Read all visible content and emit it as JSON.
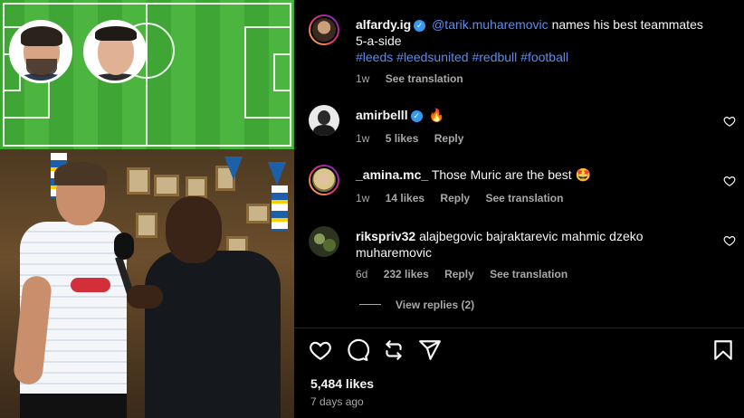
{
  "post": {
    "author": "alfardy.ig",
    "mention": "@tarik.muharemovic",
    "caption_text": "names his best teammates 5-a-side",
    "hashtags": [
      "#leeds",
      "#leedsunited",
      "#redbull",
      "#football"
    ],
    "time": "1w",
    "see_translation": "See translation"
  },
  "comments": [
    {
      "username": "amirbelll",
      "verified": true,
      "text": "🔥",
      "time": "1w",
      "likes": "5 likes",
      "reply": "Reply",
      "see_translation": ""
    },
    {
      "username": "_amina.mc_",
      "verified": false,
      "text": "Those Muric are the best 🤩",
      "time": "1w",
      "likes": "14 likes",
      "reply": "Reply",
      "see_translation": "See translation"
    },
    {
      "username": "rikspriv32",
      "verified": false,
      "text": "alajbegovic bajraktarevic mahmic dzeko muharemovic",
      "time": "6d",
      "likes": "232 likes",
      "reply": "Reply",
      "see_translation": "See translation"
    }
  ],
  "view_replies": "View replies (2)",
  "actions": {
    "like_icon": "heart-icon",
    "comment_icon": "comment-icon",
    "share_icon": "repost-icon",
    "send_icon": "send-icon",
    "save_icon": "bookmark-icon"
  },
  "likes_count": "5,484 likes",
  "post_date": "7 days ago",
  "colors": {
    "link": "#5b8cf0",
    "verified": "#3897f0",
    "muted": "#a8a8a8",
    "background": "#000000"
  }
}
